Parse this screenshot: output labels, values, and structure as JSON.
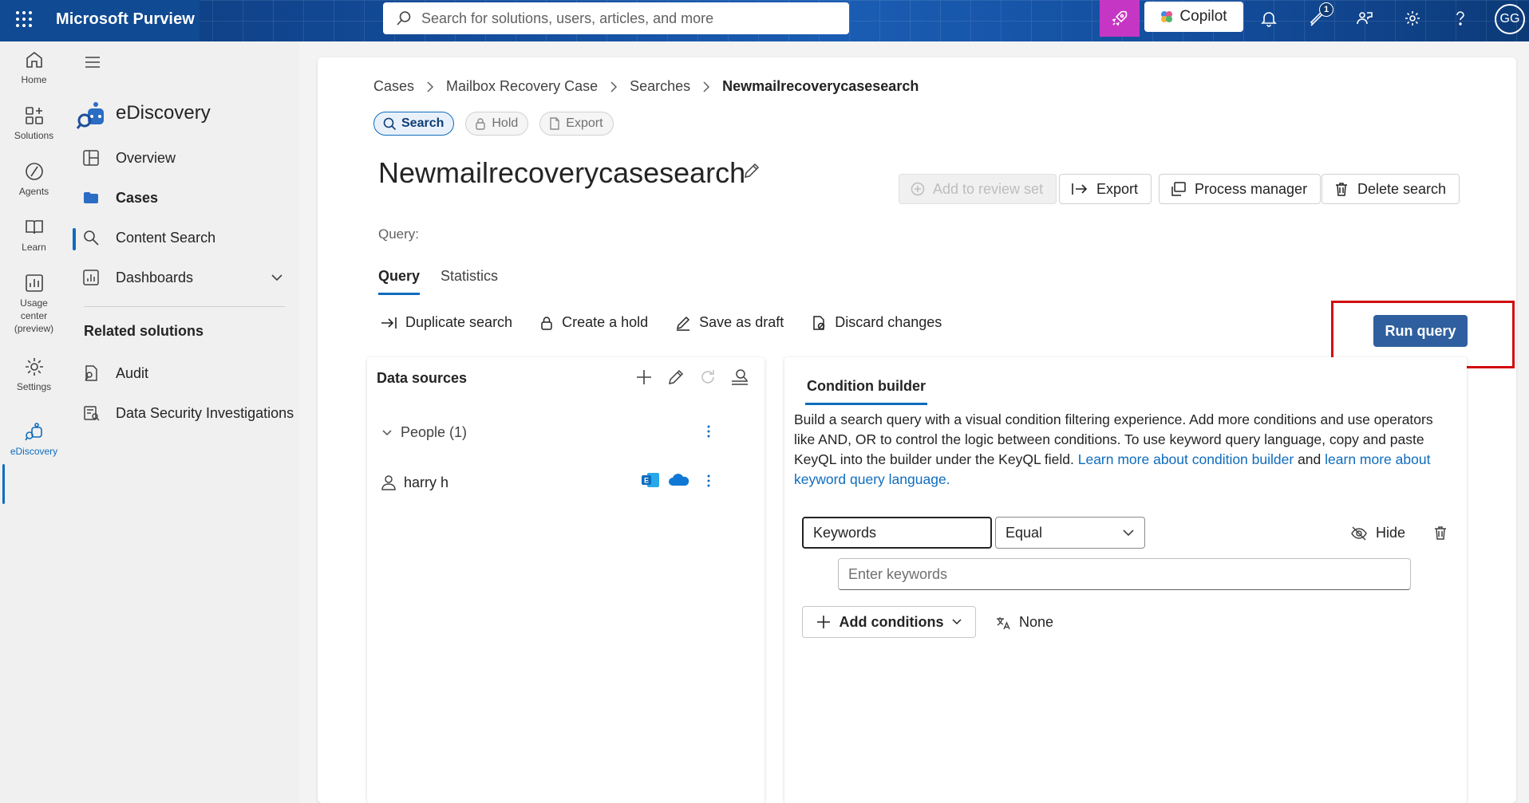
{
  "topbar": {
    "brand": "Microsoft Purview",
    "search_placeholder": "Search for solutions, users, articles, and more",
    "copilot_label": "Copilot",
    "notification_badge": "1",
    "avatar_initials": "GG"
  },
  "rail": {
    "items": [
      {
        "label": "Home"
      },
      {
        "label": "Solutions"
      },
      {
        "label": "Agents"
      },
      {
        "label": "Learn"
      },
      {
        "label": "Usage center (preview)"
      },
      {
        "label": "Settings"
      },
      {
        "label": "eDiscovery"
      }
    ]
  },
  "sidenav": {
    "app_title": "eDiscovery",
    "items": [
      {
        "label": "Overview"
      },
      {
        "label": "Cases"
      },
      {
        "label": "Content Search"
      },
      {
        "label": "Dashboards"
      }
    ],
    "related_title": "Related solutions",
    "related": [
      {
        "label": "Audit"
      },
      {
        "label": "Data Security Investigations"
      }
    ]
  },
  "breadcrumb": [
    "Cases",
    "Mailbox Recovery Case",
    "Searches",
    "Newmailrecoverycasesearch"
  ],
  "pills": [
    {
      "label": "Search"
    },
    {
      "label": "Hold"
    },
    {
      "label": "Export"
    }
  ],
  "page": {
    "title": "Newmailrecoverycasesearch",
    "query_label": "Query:"
  },
  "actions": {
    "add_to_review": "Add to review set",
    "export": "Export",
    "process_manager": "Process manager",
    "delete_search": "Delete search"
  },
  "tabs": [
    {
      "label": "Query"
    },
    {
      "label": "Statistics"
    }
  ],
  "toolbar": {
    "duplicate": "Duplicate search",
    "create_hold": "Create a hold",
    "save_draft": "Save as draft",
    "discard": "Discard changes",
    "run_query": "Run query"
  },
  "data_sources": {
    "title": "Data sources",
    "group": "People (1)",
    "rows": [
      {
        "name": "harry h"
      }
    ]
  },
  "condition_builder": {
    "tab": "Condition builder",
    "desc_text": "Build a search query with a visual condition filtering experience. Add more conditions and use operators like AND, OR to control the logic between conditions. To use keyword query language, copy and paste KeyQL into the builder under the KeyQL field. ",
    "link1": "Learn more about condition builder",
    "desc_and": " and ",
    "link2": "learn more about keyword query language.",
    "field": "Keywords",
    "operator": "Equal",
    "keywords_placeholder": "Enter keywords",
    "hide": "Hide",
    "add_conditions": "Add conditions",
    "none": "None"
  },
  "colors": {
    "accent": "#0f6cbd",
    "run_button": "#2f5f9e",
    "highlight": "#d10d0d",
    "rocket": "#c636c4"
  }
}
